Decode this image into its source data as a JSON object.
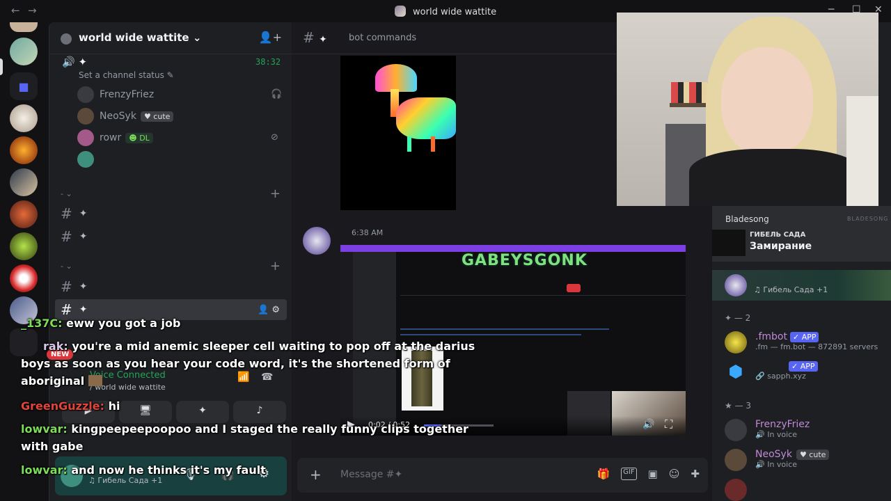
{
  "window": {
    "title": "world wide wattite"
  },
  "server": {
    "name": "world wide wattite"
  },
  "voice_channel": {
    "timer": "38:32",
    "status_prompt": "Set a channel status",
    "users": [
      {
        "name": "FrenzyFriez",
        "badge": ""
      },
      {
        "name": "NeoSyk",
        "badge": "cute"
      },
      {
        "name": "rowr",
        "badge": "DL"
      }
    ]
  },
  "channels": [
    {
      "label": "#"
    },
    {
      "label": "#"
    },
    {
      "label": "#"
    },
    {
      "label": "#"
    }
  ],
  "categories": [
    {
      "label": "-"
    },
    {
      "label": "-"
    }
  ],
  "voice_panel": {
    "status": "Voice Connected",
    "location": "/ world wide wattite"
  },
  "user_panel": {
    "activity": "Гибель Сада +1"
  },
  "main": {
    "channel_name": "bot commands",
    "message_time": "6:38 AM",
    "embed_title": "GABEYSGONK",
    "video_time": "0:02 / 0:52"
  },
  "composer": {
    "placeholder": "Message #✦"
  },
  "members": {
    "now_playing": {
      "user": "Bladesong",
      "album": "ГИБЕЛЬ САДА",
      "track": "Замирание",
      "watermark": "BLADESONG"
    },
    "activity_row": "Гибель Сада +1",
    "group_bots": "✦ — 2",
    "bots": [
      {
        "name": ".fmbot",
        "badge": "APP",
        "sub": ".fm — fm.bot — 872891 servers"
      },
      {
        "name": "",
        "badge": "APP",
        "sub": "sapph.xyz"
      }
    ],
    "group_voice": "★ — 3",
    "voice_members": [
      {
        "name": "FrenzyFriez",
        "sub": "In voice",
        "badge": ""
      },
      {
        "name": "NeoSyk",
        "sub": "In voice",
        "badge": "cute"
      }
    ]
  },
  "chat_overlay": [
    {
      "user": "_137C:",
      "text": "eww you got a job",
      "color": "#7ddc5a"
    },
    {
      "user": "rak:",
      "text": "you're a mid anemic sleeper cell waiting to pop off at the darius",
      "color": "#d6c7e8"
    },
    {
      "user": "",
      "text": "boys as soon as you hear your code word, it's the shortened form of",
      "color": "#ffffff"
    },
    {
      "user": "",
      "text": "aboriginal",
      "color": "#ffffff"
    },
    {
      "user": "GreenGuzzle:",
      "text": "hi",
      "color": "#e0443a"
    },
    {
      "user": "lowvar:",
      "text": "kingpeepeepoopoo and I staged the really funny clips together",
      "color": "#7ddc5a"
    },
    {
      "user": "",
      "text": "with gabe",
      "color": "#ffffff"
    },
    {
      "user": "lowvar:",
      "text": "and now he thinks it's my fault",
      "color": "#7ddc5a"
    }
  ],
  "new_badge": "NEW"
}
